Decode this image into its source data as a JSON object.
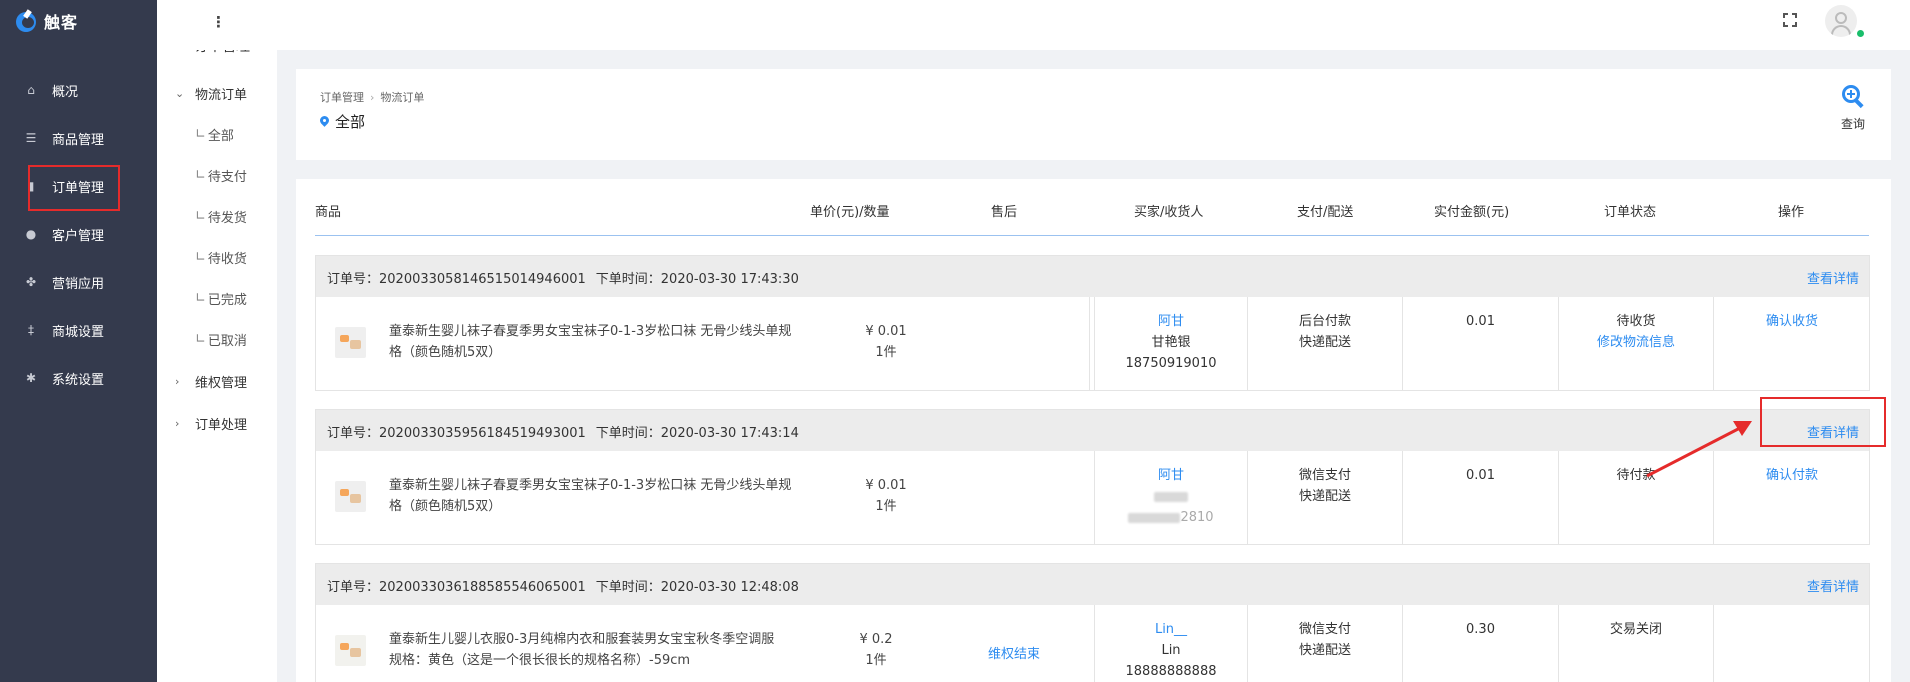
{
  "app": {
    "name": "触客"
  },
  "sidebar": {
    "items": [
      {
        "label": "概况",
        "icon": "home-icon"
      },
      {
        "label": "商品管理",
        "icon": "list-icon"
      },
      {
        "label": "订单管理",
        "icon": "order-icon"
      },
      {
        "label": "客户管理",
        "icon": "user-icon"
      },
      {
        "label": "营销应用",
        "icon": "puzzle-icon"
      },
      {
        "label": "商城设置",
        "icon": "shop-icon"
      },
      {
        "label": "系统设置",
        "icon": "gear-icon"
      }
    ]
  },
  "submenu": {
    "title": "订单管理",
    "group_logistics": "物流订单",
    "leaves": [
      "全部",
      "待支付",
      "待发货",
      "待收货",
      "已完成",
      "已取消"
    ],
    "group_rights": "维权管理",
    "group_process": "订单处理"
  },
  "header": {
    "breadcrumb": [
      "订单管理",
      "物流订单"
    ],
    "title": "全部",
    "query_label": "查询"
  },
  "table": {
    "columns": [
      "商品",
      "单价(元)/数量",
      "售后",
      "买家/收货人",
      "支付/配送",
      "实付金额(元)",
      "订单状态",
      "操作"
    ],
    "detail_label": "查看详情",
    "orders": [
      {
        "order_no": "订单号：20200330581465150149460​01",
        "order_no_text": "订单号：2020033058146515014946001",
        "time": "下单时间：2020-03-30 17:43:30",
        "product": "童泰新生婴儿袜子春夏季男女宝宝袜子0-1-3岁松口袜 无骨少线头单规格（颜色随机5双）",
        "price": "¥ 0.01",
        "qty": "1件",
        "after_sale": "",
        "buyer": "阿甘",
        "receiver": "甘艳银",
        "phone": "18750919010",
        "payment": "后台付款",
        "delivery": "快递配送",
        "amount": "0.01",
        "status": "待收货",
        "status_link": "修改物流信息",
        "action": "确认收货"
      },
      {
        "order_no_text": "订单号：2020033035956184519493001",
        "time": "下单时间：2020-03-30 17:43:14",
        "product": "童泰新生婴儿袜子春夏季男女宝宝袜子0-1-3岁松口袜 无骨少线头单规格（颜色随机5双）",
        "price": "¥ 0.01",
        "qty": "1件",
        "after_sale": "",
        "buyer": "阿甘",
        "phone_tail": "2810",
        "payment": "微信支付",
        "delivery": "快递配送",
        "amount": "0.01",
        "status": "待付款",
        "action": "确认付款"
      },
      {
        "order_no_text": "订单号：2020033036188585546065001",
        "time": "下单时间：2020-03-30 12:48:08",
        "product": "童泰新生儿婴儿衣服0-3月纯棉内衣和服套装男女宝宝秋冬季空调服",
        "spec": "规格：黄色（这是一个很长很长的规格名称）-59cm",
        "price": "¥ 0.2",
        "qty": "1件",
        "after_sale": "维权结束",
        "buyer": "Lin__",
        "receiver": "Lin",
        "phone": "18888888888",
        "payment": "微信支付",
        "delivery": "快递配送",
        "amount": "0.30",
        "status": "交易关闭"
      }
    ]
  },
  "colors": {
    "accent": "#2d8cf0",
    "sidebar": "#343a4d",
    "highlight": "#e52b2b"
  }
}
